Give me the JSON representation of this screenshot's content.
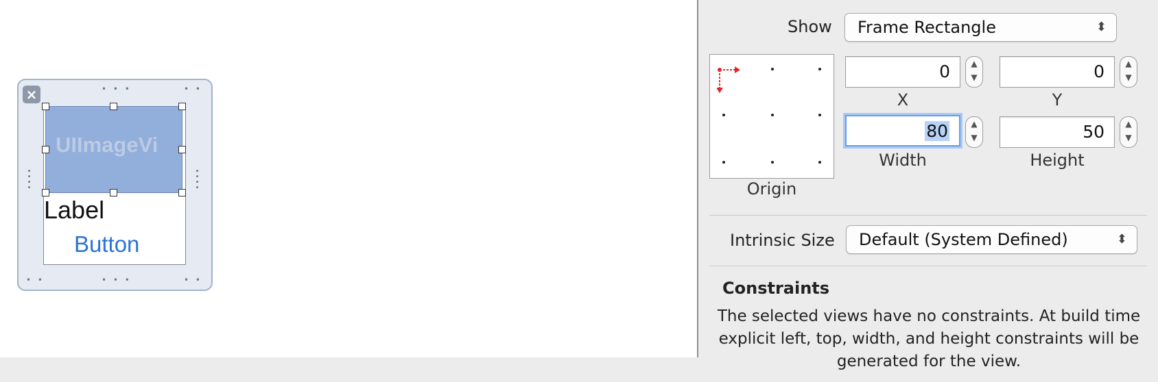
{
  "canvas": {
    "image_view_label": "UIImageVi",
    "label_text": "Label",
    "button_text": "Button",
    "close_glyph": "×"
  },
  "inspector": {
    "show_label": "Show",
    "show_value": "Frame Rectangle",
    "x_value": "0",
    "y_value": "0",
    "width_value": "80",
    "height_value": "50",
    "x_caption": "X",
    "y_caption": "Y",
    "width_caption": "Width",
    "height_caption": "Height",
    "origin_caption": "Origin",
    "intrinsic_label": "Intrinsic Size",
    "intrinsic_value": "Default (System Defined)",
    "constraints_heading": "Constraints",
    "constraints_text": "The selected views have no constraints. At build time explicit left, top, width, and height constraints will be generated for the view."
  },
  "colors": {
    "selection_fill": "#92aedb",
    "button_blue": "#2a73d9",
    "focus_ring": "#6a9ce6",
    "origin_marker": "#e0262a"
  },
  "icons": {
    "close": "close-icon",
    "popup_arrows": "updown-arrows-icon",
    "stepper": "stepper-icon",
    "origin_marker": "origin-anchor-icon"
  }
}
